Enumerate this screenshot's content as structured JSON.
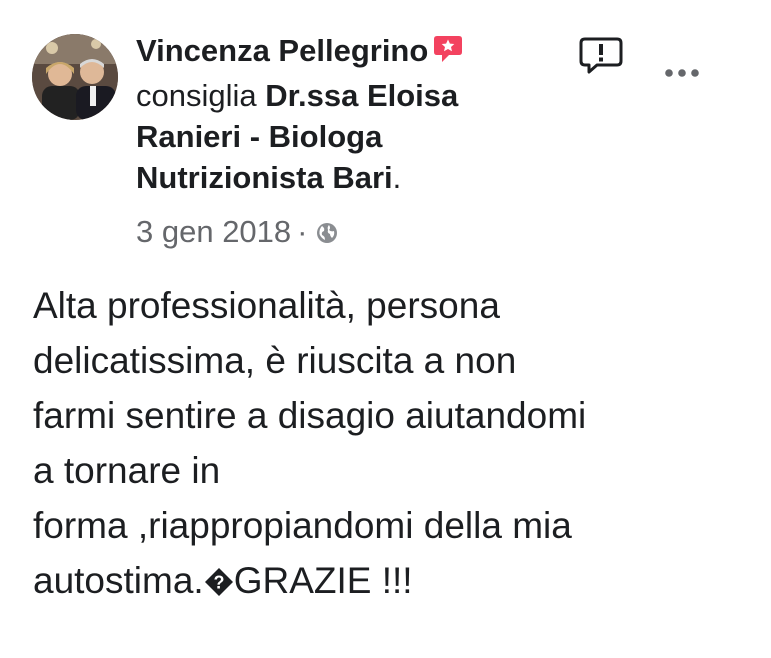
{
  "post": {
    "author_name": "Vincenza Pellegrino",
    "verb": "consiglia",
    "page_name": "Dr.ssa Eloisa Ranieri - Biologa Nutrizionista Bari",
    "period": ".",
    "date": "3 gen 2018",
    "separator": "·",
    "audience_icon": "globe-icon",
    "badge_icon": "recommend-badge-icon",
    "report_icon": "report-icon",
    "more_icon": "more-options-icon"
  },
  "review": {
    "lines": [
      "Alta professionalità, persona",
      "delicatissima, è riuscita a non",
      "farmi sentire a disagio aiutandomi",
      "a tornare in",
      "forma ,riappropiandomi della mia"
    ],
    "last_line_before": "autostima.",
    "last_line_after": "GRAZIE !!!"
  },
  "colors": {
    "text": "#1c1e21",
    "meta": "#65676b",
    "badge": "#f3425f"
  }
}
